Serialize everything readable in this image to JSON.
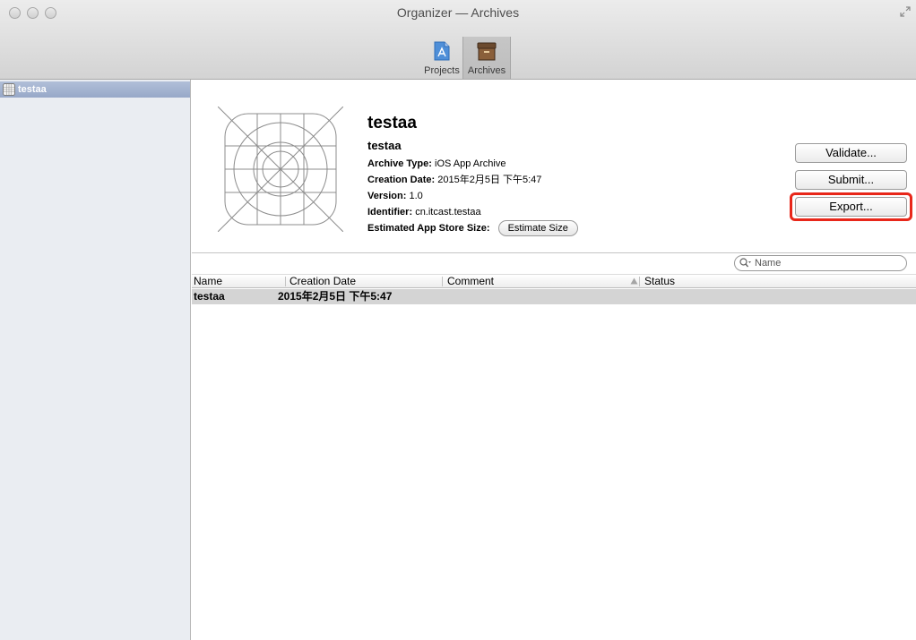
{
  "window": {
    "title": "Organizer — Archives"
  },
  "toolbar": {
    "projects_label": "Projects",
    "archives_label": "Archives"
  },
  "sidebar": {
    "items": [
      {
        "label": "testaa"
      }
    ]
  },
  "archive": {
    "name": "testaa",
    "product": "testaa",
    "archive_type_label": "Archive Type:",
    "archive_type": "iOS App Archive",
    "creation_date_label": "Creation Date:",
    "creation_date": "2015年2月5日 下午5:47",
    "version_label": "Version:",
    "version": "1.0",
    "identifier_label": "Identifier:",
    "identifier": "cn.itcast.testaa",
    "estimated_size_label": "Estimated App Store Size:",
    "estimate_button": "Estimate Size"
  },
  "actions": {
    "validate": "Validate...",
    "submit": "Submit...",
    "export": "Export..."
  },
  "search": {
    "placeholder": "Name"
  },
  "table": {
    "columns": [
      "Name",
      "Creation Date",
      "Comment",
      "Status"
    ],
    "rows": [
      {
        "name": "testaa",
        "creation_date": "2015年2月5日 下午5:47",
        "comment": "",
        "status": ""
      }
    ]
  },
  "colors": {
    "highlight": "#e8271a",
    "sidebar_selection": "#9fb0cd",
    "selected_row": "#d4d4d4"
  }
}
